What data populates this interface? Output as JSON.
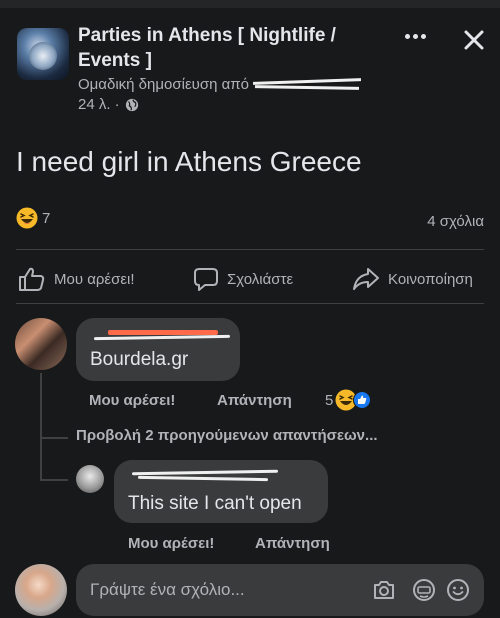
{
  "post": {
    "group_name": "Parties in Athens [ Nightlife / Events ]",
    "subtitle_prefix": "Ομαδική δημοσίευση από ",
    "time": "24 λ. ·",
    "text": "I need girl in Athens Greece",
    "reaction_count": "7",
    "comment_count": "4 σχόλια"
  },
  "actions": {
    "like": "Μου αρέσει!",
    "comment": "Σχολιάστε",
    "share": "Κοινοποίηση"
  },
  "comments": [
    {
      "text": "Bourdela.gr",
      "like_label": "Μου αρέσει!",
      "reply_label": "Απάντηση",
      "reaction_count": "5"
    }
  ],
  "view_previous_replies": "Προβολή 2 προηγούμενων απαντήσεων...",
  "reply": {
    "text": "This site I can't open",
    "like_label": "Μου αρέσει!",
    "reply_label": "Απάντηση"
  },
  "composer": {
    "placeholder": "Γράψτε ένα σχόλιο..."
  },
  "colors": {
    "background": "#18191a",
    "bubble": "#3a3b3c",
    "text_primary": "#e4e6eb",
    "text_secondary": "#b0b3b8",
    "like_blue": "#1877f2",
    "haha_yellow": "#f7b928"
  },
  "icons": [
    "more-icon",
    "close-icon",
    "globe-icon",
    "haha-reaction-icon",
    "like-reaction-icon",
    "thumbs-up-icon",
    "comment-icon",
    "share-icon",
    "camera-icon",
    "gif-icon",
    "emoji-icon"
  ]
}
